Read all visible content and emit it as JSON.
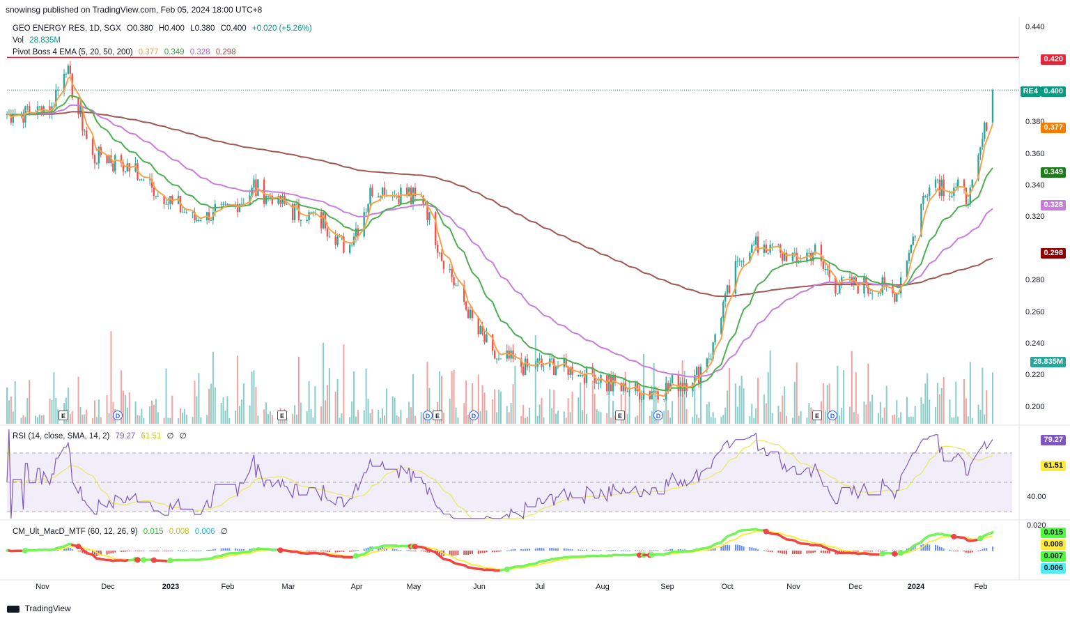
{
  "header": {
    "published": "snowinsg published on TradingView.com, Feb 05, 2024 18:00 UTC+8"
  },
  "price_legend": {
    "symbol": "GEO ENERGY RES, 1D, SGX",
    "open": "O0.380",
    "high": "H0.400",
    "low": "L0.380",
    "close": "C0.400",
    "change": "+0.020 (+5.26%)",
    "vol_label": "Vol",
    "vol_value": "28.835M",
    "ema_label": "Pivot Boss 4 EMA (5, 20, 50, 200)",
    "ema5": "0.377",
    "ema20": "0.349",
    "ema50": "0.328",
    "ema200": "0.298"
  },
  "rsi_legend": {
    "label": "RSI (14, close, SMA, 14, 2)",
    "rsi": "79.27",
    "sma": "61.51",
    "z1": "∅",
    "z2": "∅"
  },
  "macd_legend": {
    "label": "CM_Ult_MacD_MTF (60, 12, 26, 9)",
    "v1": "0.015",
    "v2": "0.008",
    "v3": "0.006",
    "z": "∅"
  },
  "tags": {
    "resistance": "0.420",
    "symbol": "RE4",
    "last": "0.400",
    "ema5": "0.377",
    "ema20": "0.349",
    "ema50": "0.328",
    "ema200": "0.298",
    "volume": "28.835M",
    "rsi": "79.27",
    "rsi_sma": "61.51",
    "macd1": "0.015",
    "macd2": "0.008",
    "macd3": "0.007",
    "macd4": "0.006"
  },
  "price_axis": [
    "0.440",
    "0.380",
    "0.360",
    "0.340",
    "0.320",
    "0.280",
    "0.260",
    "0.240",
    "0.220",
    "0.200"
  ],
  "rsi_axis": [
    "40.00"
  ],
  "macd_axis": [
    "0.020"
  ],
  "x_axis": [
    "Nov",
    "Dec",
    "2023",
    "Feb",
    "Mar",
    "Apr",
    "May",
    "Jun",
    "Jul",
    "Aug",
    "Sep",
    "Oct",
    "Nov",
    "Dec",
    "2024",
    "Feb"
  ],
  "events": [
    {
      "type": "E",
      "label": "E"
    },
    {
      "type": "D",
      "label": "D"
    },
    {
      "type": "E",
      "label": "E"
    },
    {
      "type": "D",
      "label": "D"
    },
    {
      "type": "E",
      "label": "E"
    },
    {
      "type": "D",
      "label": "D"
    },
    {
      "type": "E",
      "label": "E"
    },
    {
      "type": "D",
      "label": "D"
    },
    {
      "type": "E",
      "label": "E"
    },
    {
      "type": "D",
      "label": "D"
    }
  ],
  "footer": {
    "brand": "TradingView"
  },
  "colors": {
    "up": "#26a69a",
    "down": "#ef5350",
    "ema5": "#f7a14a",
    "ema20": "#4caf50",
    "ema50": "#c77ddb",
    "ema200": "#a0574f",
    "resistance": "#e0283a",
    "rsi": "#7e57c2",
    "rsi_sma": "#e8e85a",
    "macd_up": "#76f35a",
    "macd_down": "#f14545"
  },
  "chart_data": {
    "type": "candlestick",
    "symbol": "GEO ENERGY RES",
    "interval": "1D",
    "ylim": [
      0.195,
      0.445
    ],
    "resistance_level": 0.42,
    "x_range": [
      "2022-10-10",
      "2024-02-05"
    ],
    "anchors": {
      "dates": [
        "2022-10-10",
        "2022-11-01",
        "2022-11-08",
        "2022-11-20",
        "2022-12-05",
        "2022-12-20",
        "2023-01-10",
        "2023-01-25",
        "2023-02-08",
        "2023-02-28",
        "2023-03-15",
        "2023-03-25",
        "2023-04-08",
        "2023-04-25",
        "2023-05-03",
        "2023-05-12",
        "2023-05-24",
        "2023-06-05",
        "2023-06-20",
        "2023-07-10",
        "2023-08-01",
        "2023-08-20",
        "2023-09-10",
        "2023-09-20",
        "2023-09-28",
        "2023-10-05",
        "2023-10-15",
        "2023-10-30",
        "2023-11-10",
        "2023-11-20",
        "2023-12-05",
        "2023-12-20",
        "2023-12-28",
        "2024-01-05",
        "2024-01-15",
        "2024-01-25",
        "2024-01-30",
        "2024-02-05"
      ],
      "close": [
        0.385,
        0.39,
        0.415,
        0.36,
        0.355,
        0.34,
        0.32,
        0.325,
        0.34,
        0.325,
        0.32,
        0.3,
        0.34,
        0.335,
        0.33,
        0.295,
        0.265,
        0.235,
        0.23,
        0.23,
        0.22,
        0.215,
        0.22,
        0.24,
        0.275,
        0.3,
        0.305,
        0.295,
        0.3,
        0.28,
        0.28,
        0.275,
        0.31,
        0.345,
        0.34,
        0.335,
        0.36,
        0.4
      ]
    },
    "ema": {
      "ema5": {
        "last": 0.377
      },
      "ema20": {
        "last": 0.349
      },
      "ema50": {
        "last": 0.328
      },
      "ema200": {
        "last": 0.298
      }
    },
    "volume_last": "28.835M",
    "rsi": {
      "last": 79.27,
      "sma": 61.51,
      "levels": [
        70,
        50,
        30
      ]
    },
    "macd": {
      "last": 0.015,
      "signal": 0.008
    }
  }
}
